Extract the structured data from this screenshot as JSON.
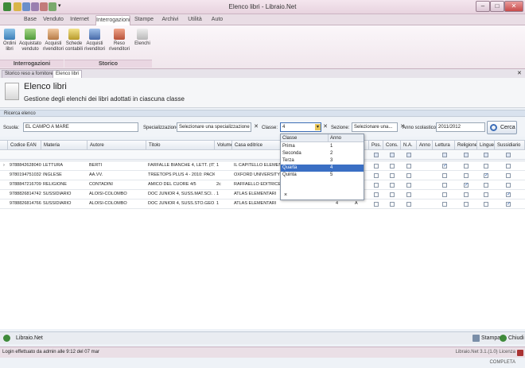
{
  "window": {
    "title": "Elenco libri - Libraio.Net"
  },
  "ribbon": {
    "tabs": [
      "Base",
      "Venduto",
      "Internet",
      "Interrogazioni",
      "Stampe",
      "Archivi",
      "Utilità",
      "Auto"
    ],
    "active_tab": "Interrogazioni",
    "group1": {
      "label": "Interrogazioni",
      "buttons": [
        [
          "Ordini",
          "libri"
        ],
        [
          "Acquistato",
          "venduto"
        ],
        [
          "Acquisti",
          "rivenditori"
        ]
      ]
    },
    "group2": {
      "label": "Storico",
      "buttons": [
        [
          "Schede",
          "contabili"
        ],
        [
          "Acquisti",
          "rivenditori"
        ],
        [
          "Reso rivenditori",
          ""
        ],
        [
          "Elenchi",
          ""
        ]
      ]
    }
  },
  "doc_tabs": [
    "Storico reso a fornitore",
    "Elenco libri"
  ],
  "header": {
    "title": "Elenco libri",
    "subtitle": "Gestione degli elenchi dei libri adottati in ciascuna classe"
  },
  "search": {
    "section_label": "Ricerca elenco",
    "scuola_label": "Scuola:",
    "scuola_value": "EL CAMPO A MARE",
    "spec_label": "Specializzazione:",
    "spec_value": "Selezionare una specializzazione",
    "classe_label": "Classe:",
    "classe_value": "4",
    "sezione_label": "Sezione:",
    "sezione_value": "Selezionare una...",
    "anno_label": "Anno scolastico:",
    "anno_value": "2011/2012",
    "cerca_label": "Cerca"
  },
  "grid": {
    "columns": [
      "Codice EAN",
      "Materia",
      "Autore",
      "Titolo",
      "Volume",
      "Casa editrice",
      "Pos.",
      "Cons.",
      "N.A.",
      "Anno",
      "Lettura",
      "Religione",
      "Lingue",
      "Sussidiario"
    ],
    "rows": [
      {
        "ean": "9788842628040",
        "materia": "LETTURA",
        "autore": "BERTI",
        "titolo": "FARFALLE BIANCHE 4, LETT. (IT)",
        "volume": "1",
        "editrice": "IL CAPITELLO ELEMENTA",
        "lettura": true,
        "religione": false,
        "lingue": false,
        "sussidiario": false
      },
      {
        "ean": "9780194751032",
        "materia": "INGLESE",
        "autore": "AA.VV.",
        "titolo": "TREETOPS PLUS 4 - 2010: PACK ...",
        "volume": "",
        "editrice": "OXFORD UNIVERSITY PR",
        "lettura": false,
        "religione": false,
        "lingue": true,
        "sussidiario": false
      },
      {
        "ean": "9788847216709",
        "materia": "RELIGIONE",
        "autore": "CONTADINI",
        "titolo": "AMICO DEL CUORE 4/5",
        "volume": "2c",
        "editrice": "RAFFAELLO EDITRICE",
        "lettura": false,
        "religione": true,
        "lingue": false,
        "sussidiario": false
      },
      {
        "ean": "9788826814742",
        "materia": "SUSSIDIARIO",
        "autore": "ALOISI-COLOMBO",
        "titolo": "DOC JUNIOR 4, SUSS.MAT.SCI. ...",
        "volume": "1",
        "editrice": "ATLAS ELEMENTARI",
        "lettura": false,
        "religione": false,
        "lingue": false,
        "sussidiario": true
      },
      {
        "ean": "9788826814766",
        "materia": "SUSSIDIARIO",
        "autore": "ALOISI-COLOMBO",
        "titolo": "DOC JUNIOR 4, SUSS.STO.GEO. ...",
        "volume": "1",
        "editrice": "ATLAS ELEMENTARI",
        "lettura": false,
        "religione": false,
        "lingue": false,
        "sussidiario": true,
        "anno": "4",
        "na": "A"
      }
    ]
  },
  "dropdown": {
    "headers": [
      "Classe",
      "Anno"
    ],
    "items": [
      {
        "classe": "Prima",
        "anno": "1"
      },
      {
        "classe": "Seconda",
        "anno": "2"
      },
      {
        "classe": "Terza",
        "anno": "3"
      },
      {
        "classe": "Quarta",
        "anno": "4"
      },
      {
        "classe": "Quinta",
        "anno": "5"
      }
    ],
    "selected_index": 3,
    "clear": "×"
  },
  "footer": {
    "brand": "Libraio.Net",
    "stampa": "Stampa",
    "chiudi": "Chiudi"
  },
  "status": {
    "left": "Login effettuato da admin alle 9:12 del 07 mar",
    "right": "Libraio.Net 3.1.(1.0) Licenza COMPLETA"
  }
}
